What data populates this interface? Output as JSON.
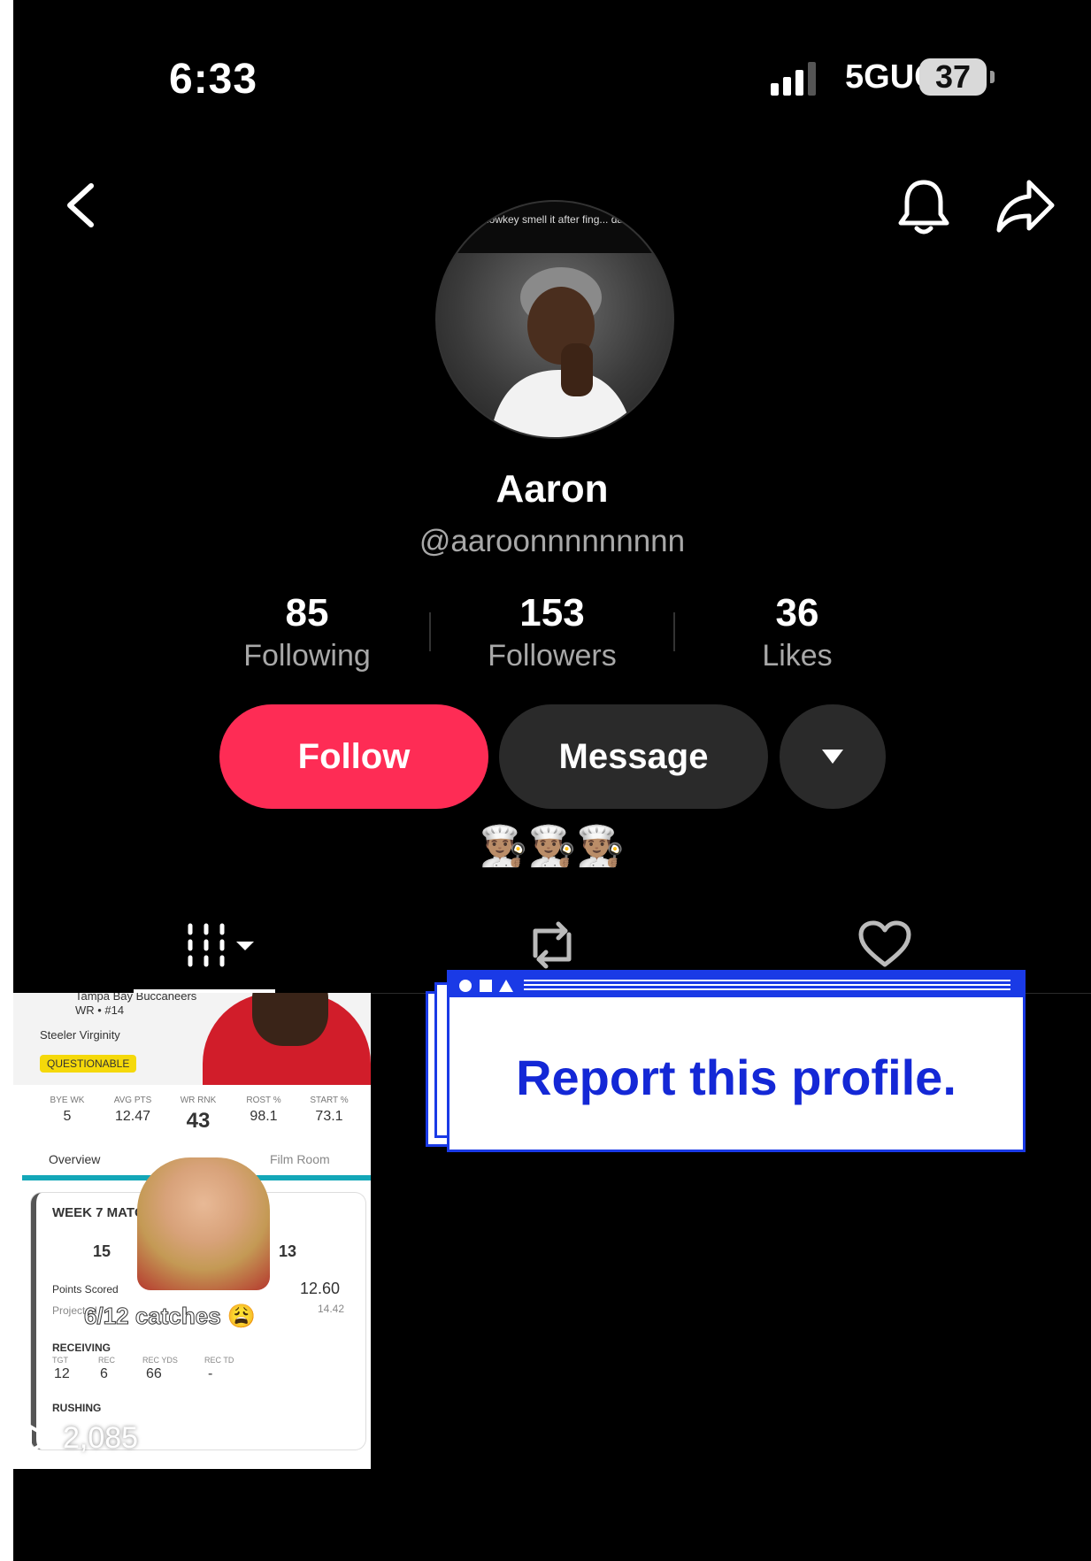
{
  "status_bar": {
    "time": "6:33",
    "network": "5GUC",
    "battery": "37"
  },
  "profile": {
    "display_name": "Aaron",
    "username": "@aaroonnnnnnnnn",
    "avatar_caption": "lowkey smell it after fing... date",
    "stats": [
      {
        "value": "85",
        "label": "Following"
      },
      {
        "value": "153",
        "label": "Followers"
      },
      {
        "value": "36",
        "label": "Likes"
      }
    ],
    "bio": "👨🏽‍🍳👨🏽‍🍳👨🏽‍🍳"
  },
  "actions": {
    "follow": "Follow",
    "message": "Message"
  },
  "video": {
    "team": "Tampa Bay Buccaneers",
    "position": "WR • #14",
    "league": "Steeler Virginity",
    "status": "QUESTIONABLE",
    "stat_headers": [
      "BYE WK",
      "AVG PTS",
      "WR RNK",
      "ROST %",
      "START %"
    ],
    "stat_values": [
      "5",
      "12.47",
      "43",
      "98.1",
      "73.1"
    ],
    "tabs": [
      "Overview",
      "Film Room"
    ],
    "week_label": "WEEK 7 MATC",
    "score_left": "15",
    "score_right": "13",
    "points_label": "Points Scored",
    "points_value": "12.60",
    "projected_label": "Projected",
    "projected_value": "14.42",
    "overlay_caption": "6/12 catches 😩",
    "receiving_label": "RECEIVING",
    "receiving_headers": [
      "TGT",
      "REC",
      "REC YDS",
      "REC TD"
    ],
    "receiving_values": [
      "12",
      "6",
      "66",
      "-"
    ],
    "rushing_label": "RUSHING",
    "views": "2,085"
  },
  "report_popup": {
    "text": "Report this profile."
  }
}
